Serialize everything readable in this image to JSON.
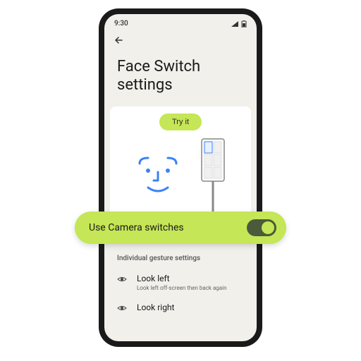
{
  "status_bar": {
    "time": "9:30"
  },
  "page": {
    "title": "Face Switch settings"
  },
  "try_button": {
    "label": "Try it"
  },
  "highlight": {
    "label": "Use Camera switches",
    "toggle_on": true
  },
  "gestures": {
    "section_title": "Individual gesture settings",
    "items": [
      {
        "title": "Look left",
        "description": "Look left off-screen then back again"
      },
      {
        "title": "Look right",
        "description": ""
      }
    ]
  }
}
